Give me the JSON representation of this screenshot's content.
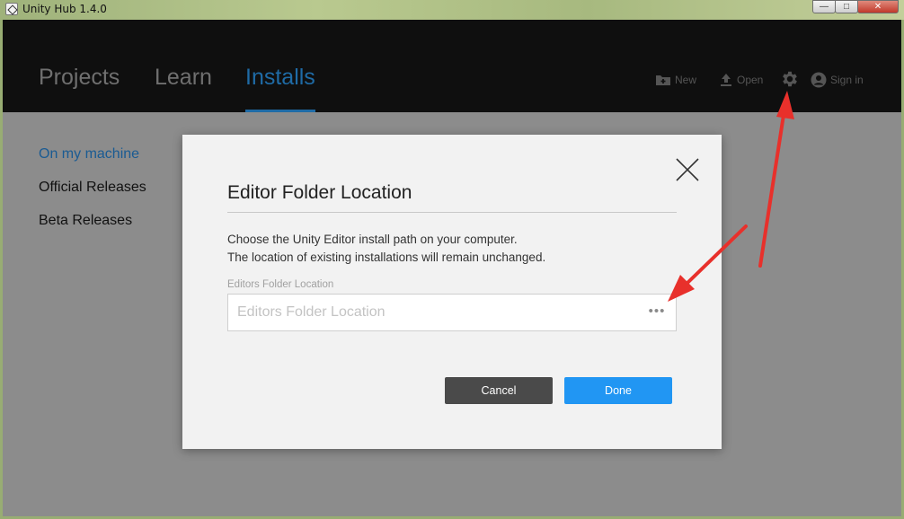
{
  "window": {
    "title": "Unity Hub 1.4.0",
    "controls": {
      "minimize": "—",
      "maximize": "□",
      "close": "✕"
    }
  },
  "header": {
    "tabs": [
      {
        "label": "Projects",
        "active": false
      },
      {
        "label": "Learn",
        "active": false
      },
      {
        "label": "Installs",
        "active": true
      }
    ],
    "actions": {
      "new_label": "New",
      "open_label": "Open",
      "settings_icon": "gear-icon",
      "signin_label": "Sign in"
    }
  },
  "sidebar": {
    "items": [
      {
        "label": "On my machine",
        "active": true
      },
      {
        "label": "Official Releases",
        "active": false
      },
      {
        "label": "Beta Releases",
        "active": false
      }
    ]
  },
  "dialog": {
    "title": "Editor Folder Location",
    "description_line1": "Choose the Unity Editor install path on your computer.",
    "description_line2": "The location of existing installations will remain unchanged.",
    "field_label": "Editors Folder Location",
    "field_value": "",
    "field_placeholder": "Editors Folder Location",
    "browse_label": "•••",
    "cancel_label": "Cancel",
    "done_label": "Done"
  },
  "colors": {
    "accent": "#1f6ba6",
    "done_button": "#2196f3",
    "cancel_button": "#4a4a4a",
    "header_bg": "#0f0f0f",
    "annotation_arrow": "#e8302b"
  }
}
